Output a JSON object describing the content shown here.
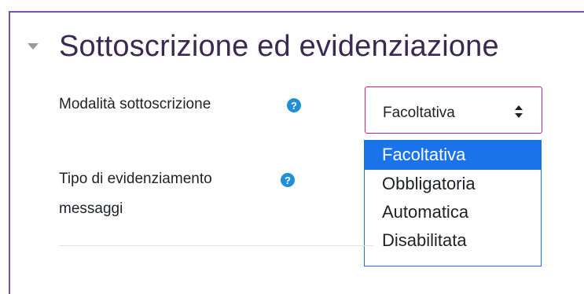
{
  "section": {
    "title": "Sottoscrizione ed evidenziazione"
  },
  "subscription": {
    "label": "Modalità sottoscrizione",
    "help_icon": "question-circle-icon",
    "selected": "Facoltativa",
    "options": [
      "Facoltativa",
      "Obbligatoria",
      "Automatica",
      "Disabilitata"
    ]
  },
  "tracking": {
    "label_line1": "Tipo di evidenziamento",
    "label_line2": "messaggi",
    "help_icon": "question-circle-icon"
  },
  "colors": {
    "accent": "#1a73e8",
    "focus_border": "#c5247a",
    "help_icon": "#1f8fd6",
    "frame": "#7b4fb3"
  }
}
